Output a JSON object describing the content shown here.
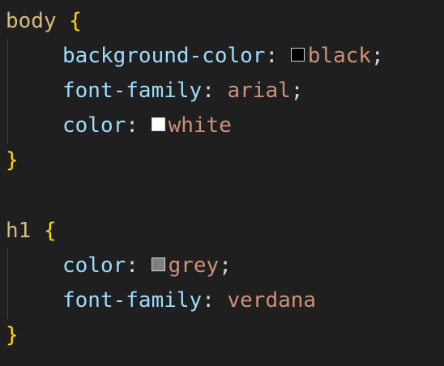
{
  "rules": [
    {
      "selector": "body",
      "open_brace": "{",
      "close_brace": "}",
      "declarations": [
        {
          "property": "background-color",
          "colon": ":",
          "value": "black",
          "terminator": ";",
          "swatch_color": "#000000"
        },
        {
          "property": "font-family",
          "colon": ":",
          "value": "arial",
          "terminator": ";"
        },
        {
          "property": "color",
          "colon": ":",
          "value": "white",
          "terminator": "",
          "swatch_color": "#ffffff"
        }
      ]
    },
    {
      "selector": "h1",
      "open_brace": "{",
      "close_brace": "}",
      "declarations": [
        {
          "property": "color",
          "colon": ":",
          "value": "grey",
          "terminator": ";",
          "swatch_color": "#808080"
        },
        {
          "property": "font-family",
          "colon": ":",
          "value": "verdana",
          "terminator": ""
        }
      ]
    }
  ],
  "theme": {
    "background": "#1f1f1f",
    "selector_color": "#d7ba7d",
    "brace_color": "#ffd700",
    "property_color": "#9cdcfe",
    "value_color": "#ce9178",
    "punctuation_color": "#d4d4d4"
  }
}
